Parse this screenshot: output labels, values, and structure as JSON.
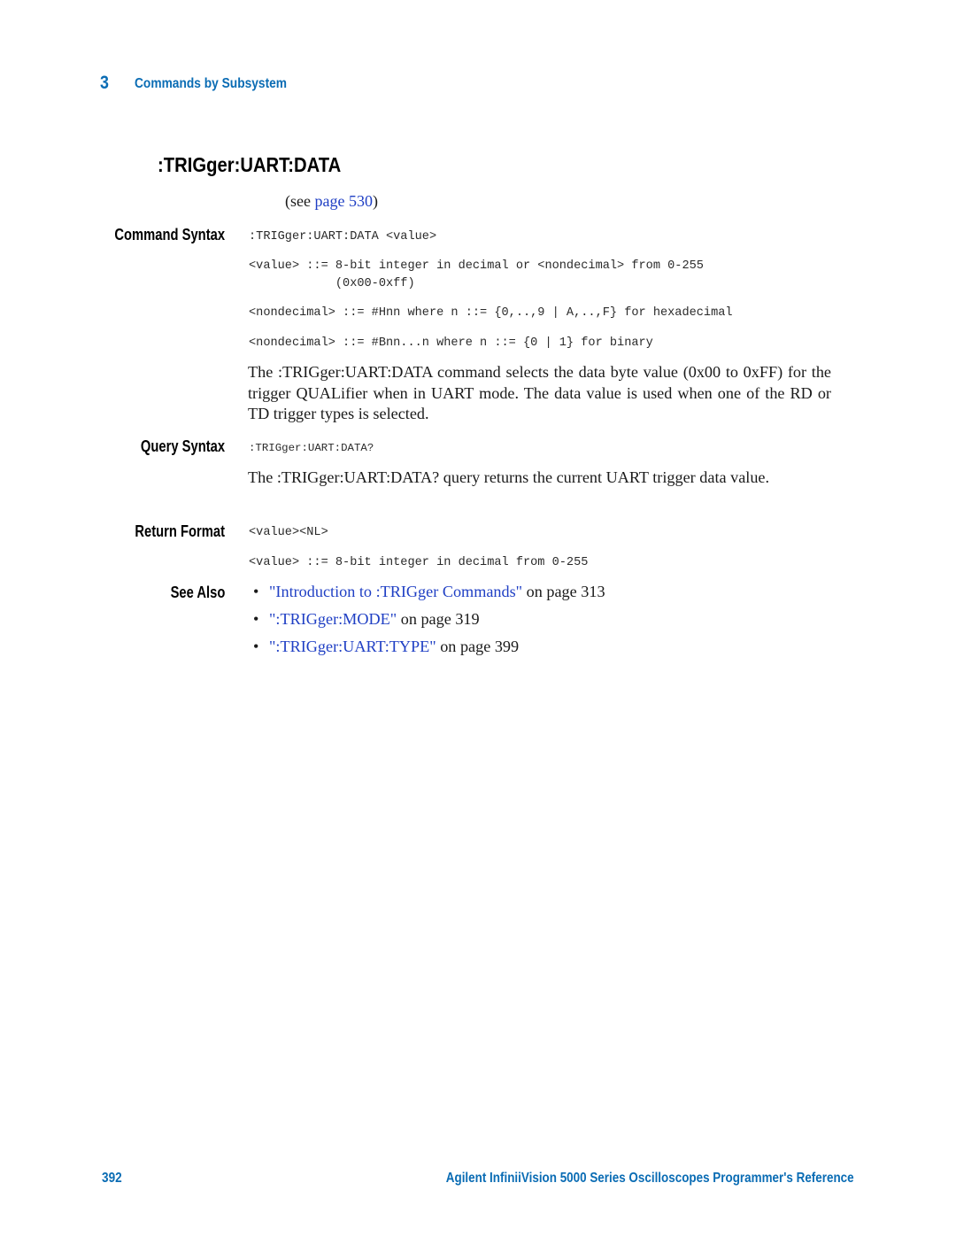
{
  "header": {
    "chapter_number": "3",
    "chapter_title": "Commands by Subsystem"
  },
  "command": {
    "title": ":TRIGger:UART:DATA",
    "see_prefix": "(see ",
    "see_link": "page 530",
    "see_suffix": ")"
  },
  "command_syntax": {
    "label": "Command Syntax",
    "lines": [
      ":TRIGger:UART:DATA <value>",
      "<value> ::= 8-bit integer in decimal or <nondecimal> from 0-255",
      "            (0x00-0xff)",
      "<nondecimal> ::= #Hnn where n ::= {0,..,9 | A,..,F} for hexadecimal",
      "<nondecimal> ::= #Bnn...n where n ::= {0 | 1} for binary"
    ],
    "description": "The :TRIGger:UART:DATA command selects the data byte value (0x00 to 0xFF) for the trigger QUALifier when in UART mode. The data value is used when one of the RD or TD trigger types is selected."
  },
  "query_syntax": {
    "label": "Query Syntax",
    "line": ":TRIGger:UART:DATA?",
    "description": "The :TRIGger:UART:DATA? query returns the current UART trigger data value."
  },
  "return_format": {
    "label": "Return Format",
    "lines": [
      "<value><NL>",
      "<value> ::= 8-bit integer in decimal from 0-255"
    ]
  },
  "see_also": {
    "label": "See Also",
    "bullet": "•",
    "items": [
      {
        "link": "\"Introduction to :TRIGger Commands\"",
        "suffix": " on page 313"
      },
      {
        "link": "\":TRIGger:MODE\"",
        "suffix": " on page 319"
      },
      {
        "link": "\":TRIGger:UART:TYPE\"",
        "suffix": " on page 399"
      }
    ]
  },
  "footer": {
    "page_number": "392",
    "book_title": "Agilent InfiniiVision 5000 Series Oscilloscopes Programmer's Reference"
  },
  "colors": {
    "accent_blue": "#0a6cb4",
    "link_blue": "#1f3fc4",
    "text": "#1a1a1a"
  }
}
